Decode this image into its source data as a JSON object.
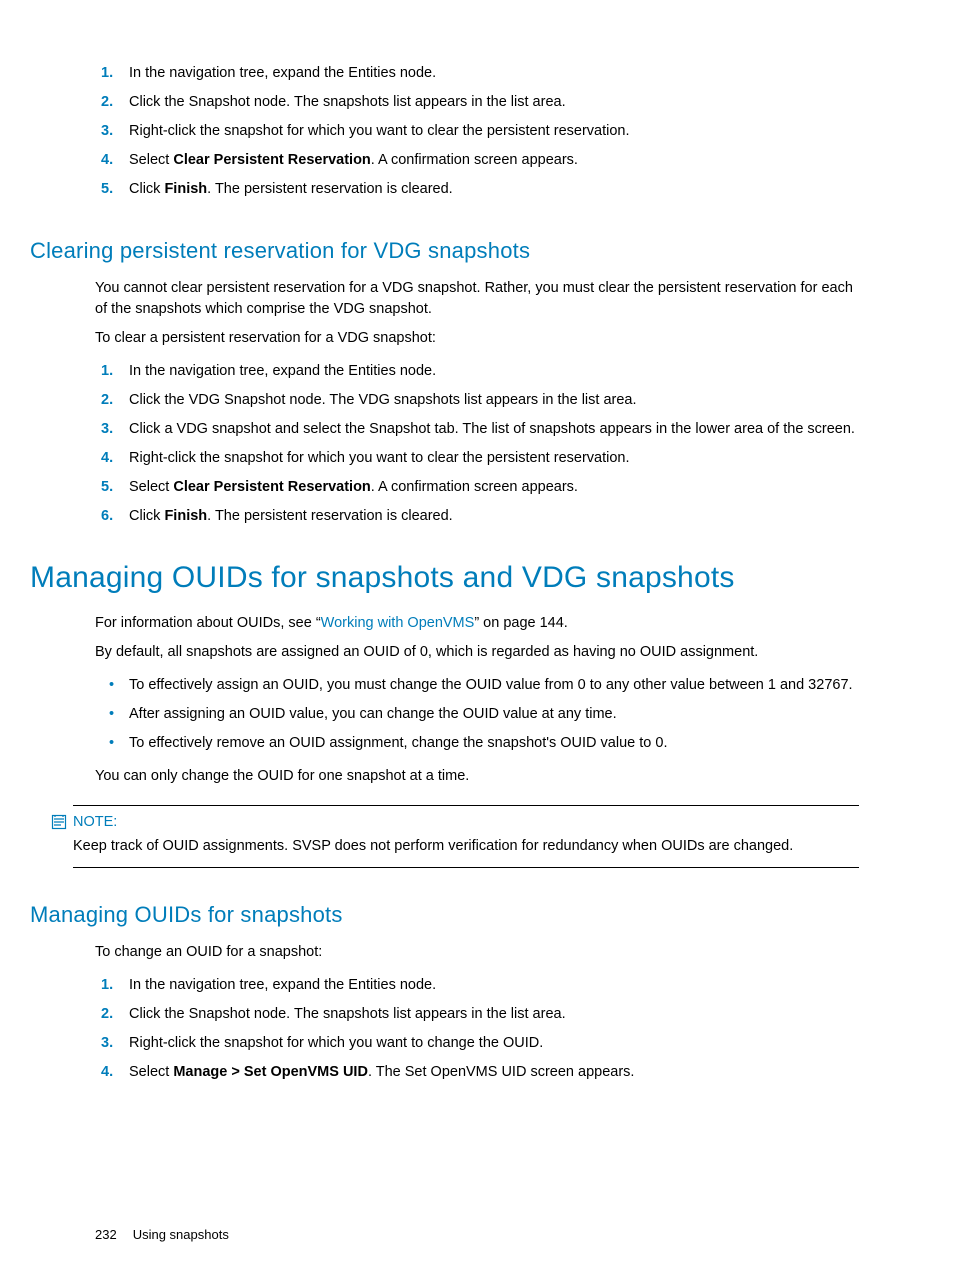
{
  "steps_top": {
    "s1": "In the navigation tree, expand the Entities node.",
    "s2": "Click the Snapshot node. The snapshots list appears in the list area.",
    "s3": "Right-click the snapshot for which you want to clear the persistent reservation.",
    "s4_pre": "Select ",
    "s4_bold": "Clear Persistent Reservation",
    "s4_post": ". A confirmation screen appears.",
    "s5_pre": "Click ",
    "s5_bold": "Finish",
    "s5_post": ". The persistent reservation is cleared."
  },
  "section_vdg": {
    "heading": "Clearing persistent reservation for VDG snapshots",
    "p1": "You cannot clear persistent reservation for a VDG snapshot. Rather, you must clear the persistent reservation for each of the snapshots which comprise the VDG snapshot.",
    "p2": "To clear a persistent reservation for a VDG snapshot:",
    "s1": "In the navigation tree, expand the Entities node.",
    "s2": "Click the VDG Snapshot node. The VDG snapshots list appears in the list area.",
    "s3": "Click a VDG snapshot and select the Snapshot tab. The list of snapshots appears in the lower area of the screen.",
    "s4": "Right-click the snapshot for which you want to clear the persistent reservation.",
    "s5_pre": "Select ",
    "s5_bold": "Clear Persistent Reservation",
    "s5_post": ". A confirmation screen appears.",
    "s6_pre": "Click ",
    "s6_bold": "Finish",
    "s6_post": ". The persistent reservation is cleared."
  },
  "section_ouid": {
    "heading": "Managing OUIDs for snapshots and VDG snapshots",
    "p1_pre": "For information about OUIDs, see “",
    "p1_link": "Working with OpenVMS",
    "p1_post": "” on page 144.",
    "p2": "By default, all snapshots are assigned an OUID of 0, which is regarded as having no OUID assignment.",
    "b1": "To effectively assign an OUID, you must change the OUID value from 0 to any other value between 1 and 32767.",
    "b2": "After assigning an OUID value, you can change the OUID value at any time.",
    "b3": "To effectively remove an OUID assignment, change the snapshot's OUID value to 0.",
    "p3": "You can only change the OUID for one snapshot at a time.",
    "note_label": "NOTE:",
    "note_body": "Keep track of OUID assignments. SVSP does not perform verification for redundancy when OUIDs are changed."
  },
  "section_ouid_snap": {
    "heading": "Managing OUIDs for snapshots",
    "p1": "To change an OUID for a snapshot:",
    "s1": "In the navigation tree, expand the Entities node.",
    "s2": "Click the Snapshot node. The snapshots list appears in the list area.",
    "s3": "Right-click the snapshot for which you want to change the OUID.",
    "s4_pre": "Select ",
    "s4_bold": "Manage > Set OpenVMS UID",
    "s4_post": ". The Set OpenVMS UID screen appears."
  },
  "footer": {
    "page": "232",
    "title": "Using snapshots"
  }
}
